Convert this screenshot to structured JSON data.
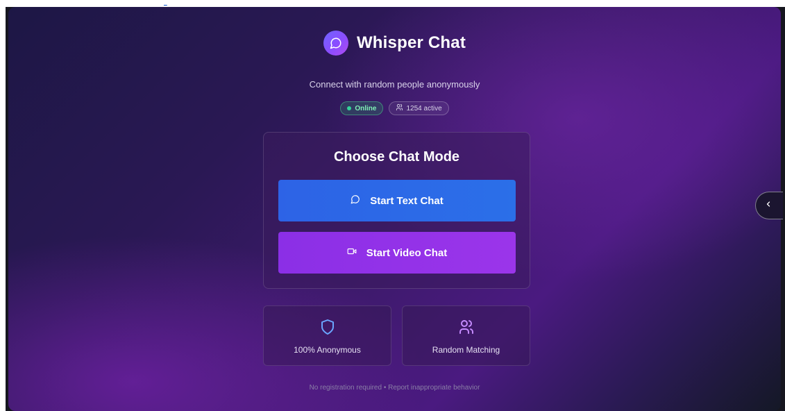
{
  "app": {
    "title": "Whisper Chat",
    "subtitle": "Connect with random people anonymously"
  },
  "status": {
    "online_label": "Online",
    "active_label": "1254 active"
  },
  "mode_card": {
    "title": "Choose Chat Mode",
    "text_chat_label": "Start Text Chat",
    "video_chat_label": "Start Video Chat"
  },
  "features": [
    {
      "label": "100% Anonymous",
      "icon": "shield-icon"
    },
    {
      "label": "Random Matching",
      "icon": "users-icon"
    }
  ],
  "footer": {
    "note": "No registration required • Report inappropriate behavior"
  },
  "colors": {
    "text_button": "#2d63e6",
    "video_button": "#8b2fe6",
    "online_green": "#34d399",
    "accent_purple": "#8b4dff"
  }
}
